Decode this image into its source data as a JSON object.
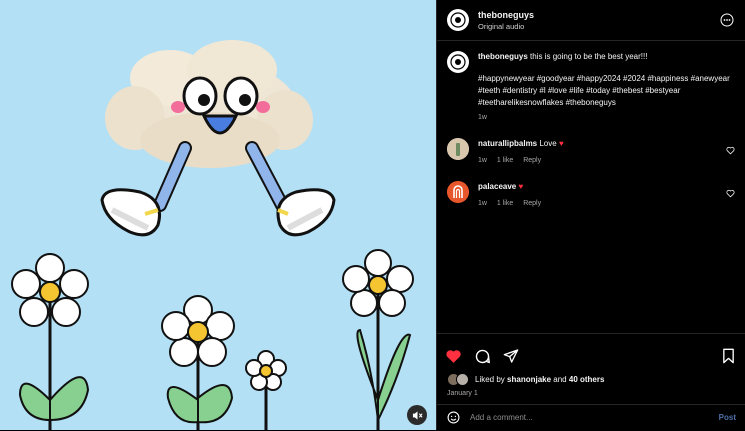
{
  "header": {
    "username": "theboneguys",
    "subtitle": "Original audio",
    "more_icon": "more-horizontal-icon"
  },
  "caption": {
    "username": "theboneguys",
    "text": "this is going to be the best year!!!",
    "hashtags": "#happynewyear #goodyear #happy2024 #2024 #happiness #anewyear #teeth #dentistry #l #love #life #today #thebest #bestyear #teetharelikesnowflakes #theboneguys",
    "time": "1w"
  },
  "comments": [
    {
      "username": "naturallipbalms",
      "text": "Love",
      "time": "1w",
      "likes": "1 like",
      "reply": "Reply"
    },
    {
      "username": "palaceave",
      "text": "",
      "time": "1w",
      "likes": "1 like",
      "reply": "Reply"
    }
  ],
  "actions": {
    "liked_by_prefix": "Liked by",
    "liked_by_user": "shanonjake",
    "liked_by_and": "and",
    "liked_by_others": "40 others",
    "date": "January 1"
  },
  "composer": {
    "placeholder": "Add a comment...",
    "post_label": "Post"
  },
  "colors": {
    "like_red": "#ff3040",
    "media_bg": "#b3e0f5",
    "post_blue": "#4f6fa8"
  }
}
